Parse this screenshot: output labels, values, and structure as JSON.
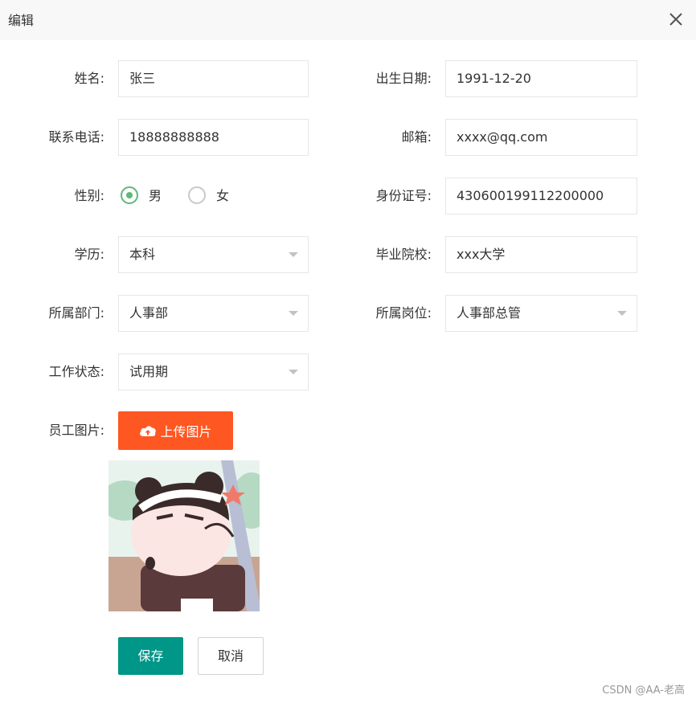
{
  "dialog": {
    "title": "编辑",
    "close_icon": "close-icon"
  },
  "form": {
    "name": {
      "label": "姓名:",
      "value": "张三"
    },
    "birthday": {
      "label": "出生日期:",
      "value": "1991-12-20"
    },
    "phone": {
      "label": "联系电话:",
      "value": "18888888888"
    },
    "email": {
      "label": "邮箱:",
      "value": "xxxx@qq.com"
    },
    "gender": {
      "label": "性别:",
      "options": [
        "男",
        "女"
      ],
      "selected": "男"
    },
    "id_number": {
      "label": "身份证号:",
      "value": "430600199112200000"
    },
    "education": {
      "label": "学历:",
      "value": "本科"
    },
    "school": {
      "label": "毕业院校:",
      "value": "xxx大学"
    },
    "department": {
      "label": "所属部门:",
      "value": "人事部"
    },
    "position": {
      "label": "所属岗位:",
      "value": "人事部总管"
    },
    "work_status": {
      "label": "工作状态:",
      "value": "试用期"
    },
    "photo": {
      "label": "员工图片:",
      "upload_label": "上传图片"
    }
  },
  "actions": {
    "save_label": "保存",
    "cancel_label": "取消"
  },
  "watermark": "CSDN @AA-老高",
  "colors": {
    "accent_green": "#009688",
    "upload_orange": "#ff5722",
    "radio_green": "#5fb878"
  }
}
